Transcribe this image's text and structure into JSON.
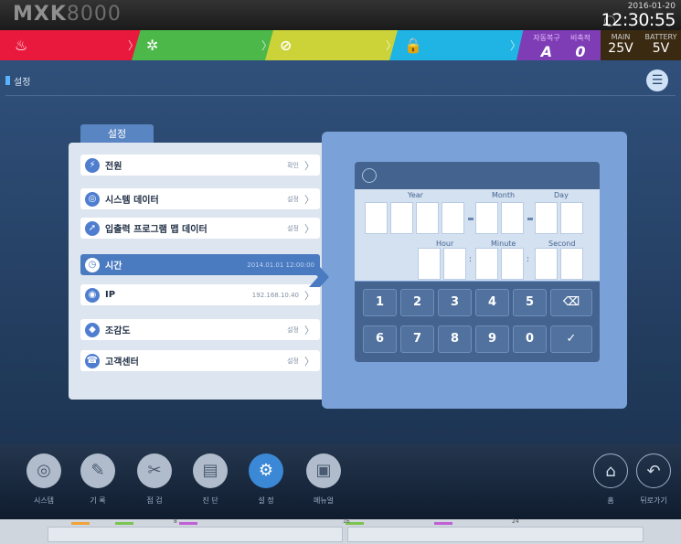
{
  "app": {
    "logo_bold": "MXK",
    "logo_light": "8000"
  },
  "datetime": {
    "date": "2016-01-20",
    "time": "12:30:55"
  },
  "status": {
    "segments": [
      {
        "name": "red",
        "icon": "fire-icon",
        "color": "#e8193d"
      },
      {
        "name": "green",
        "icon": "gear-icon",
        "color": "#4db84a"
      },
      {
        "name": "yellow",
        "icon": "no-entry-icon",
        "color": "#cbd338"
      },
      {
        "name": "cyan",
        "icon": "lock-icon",
        "color": "#1fb4e4"
      }
    ],
    "auto_restore": {
      "label": "자동복구",
      "value": "A"
    },
    "siren": {
      "label": "비축적",
      "value": "0"
    },
    "main_power": {
      "label": "MAIN",
      "value": "25V"
    },
    "battery": {
      "label": "BATTERY",
      "value": "5V"
    }
  },
  "breadcrumb": "설정",
  "panel": {
    "tab_label": "설정",
    "rows": [
      {
        "label": "전원",
        "value": "확인",
        "icon": "plug-icon"
      },
      {
        "label": "시스템 데이터",
        "value": "설정",
        "icon": "globe-icon"
      },
      {
        "label": "입출력 프로그램 맵 데이터",
        "value": "설정",
        "icon": "compass-icon"
      },
      {
        "label": "시간",
        "value": "2014.01.01 12:00:00",
        "icon": "clock-icon",
        "selected": true
      },
      {
        "label": "IP",
        "value": "192.168.10.40",
        "icon": "target-icon"
      },
      {
        "label": "조감도",
        "value": "설정",
        "icon": "layers-icon"
      },
      {
        "label": "고객센터",
        "value": "설정",
        "icon": "headset-icon"
      }
    ]
  },
  "editor": {
    "labels": {
      "year": "Year",
      "month": "Month",
      "day": "Day",
      "hour": "Hour",
      "minute": "Minute",
      "second": "Second"
    },
    "keys": [
      "1",
      "2",
      "3",
      "4",
      "5",
      "6",
      "7",
      "8",
      "9",
      "0"
    ],
    "backspace_icon": "backspace-icon",
    "confirm_icon": "checkmark-icon"
  },
  "nav": {
    "items": [
      {
        "label": "시스템",
        "icon": "globe-icon"
      },
      {
        "label": "기 록",
        "icon": "pencil-icon"
      },
      {
        "label": "점 검",
        "icon": "tools-icon"
      },
      {
        "label": "진 단",
        "icon": "clipboard-icon"
      },
      {
        "label": "설 정",
        "icon": "gear-icon",
        "active": true
      },
      {
        "label": "메뉴얼",
        "icon": "book-icon"
      }
    ],
    "home": {
      "label": "홈",
      "icon": "home-icon"
    },
    "back": {
      "label": "뒤로가기",
      "icon": "back-icon"
    }
  },
  "footer": {
    "marks": [
      "8",
      "16",
      "24"
    ]
  }
}
